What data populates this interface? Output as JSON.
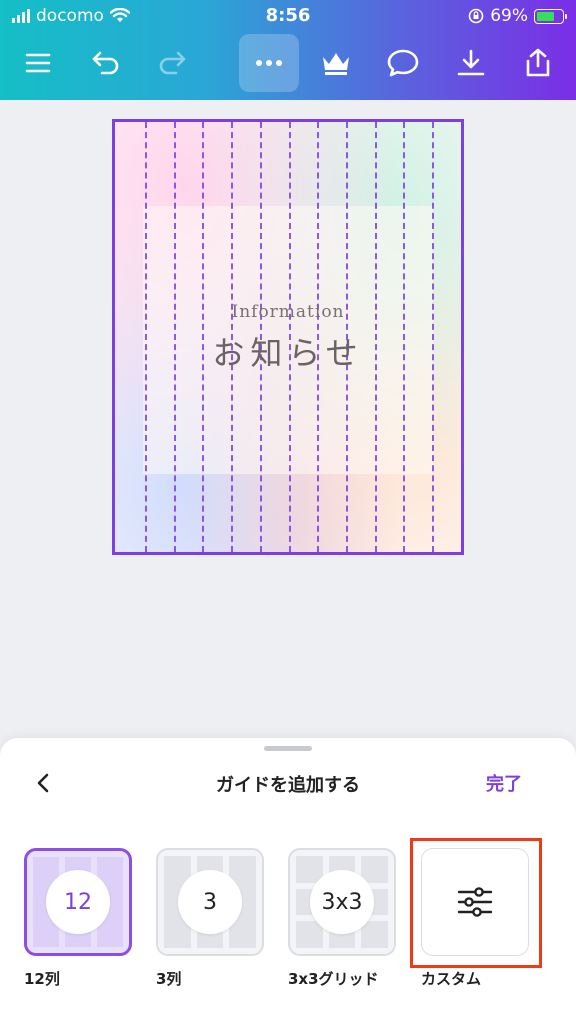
{
  "status_bar": {
    "carrier": "docomo",
    "time": "8:56",
    "battery": "69%"
  },
  "toolbar": {
    "icons": [
      "menu-icon",
      "undo-icon",
      "redo-icon",
      "more-icon",
      "crown-icon",
      "comment-icon",
      "download-icon",
      "share-icon"
    ]
  },
  "design": {
    "subtitle": "Information",
    "title": "お知らせ",
    "guide_columns": 12
  },
  "sheet": {
    "title": "ガイドを追加する",
    "done": "完了",
    "options": [
      {
        "value": "12",
        "label": "12列",
        "selected": true
      },
      {
        "value": "3",
        "label": "3列",
        "selected": false
      },
      {
        "value": "3x3",
        "label": "3x3グリッド",
        "selected": false
      },
      {
        "value": "",
        "label": "カスタム",
        "selected": false
      }
    ]
  },
  "colors": {
    "accent": "#7b3fe4",
    "highlight": "#f03a17"
  }
}
